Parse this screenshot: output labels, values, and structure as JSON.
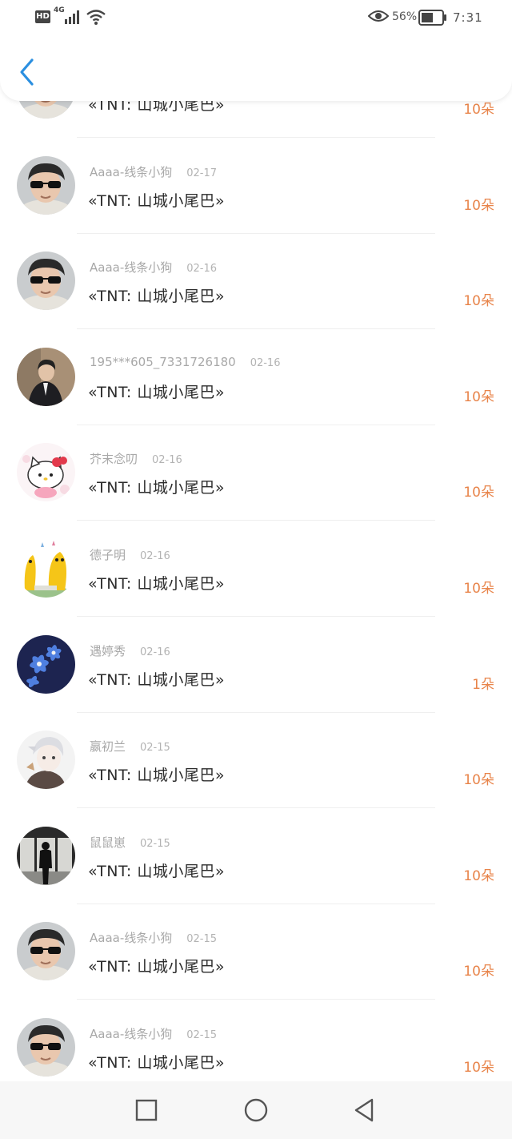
{
  "status_bar": {
    "hd_badge": "HD",
    "network": "4G",
    "battery_percent": "56%",
    "time": "7:31",
    "icons": [
      "hd-icon",
      "signal-icon",
      "wifi-icon",
      "eye-icon",
      "battery-icon"
    ]
  },
  "header": {
    "back_icon": "chevron-left-icon"
  },
  "colors": {
    "accent": "#2b8fe0",
    "count": "#e8844a",
    "meta": "#a8a8a8",
    "title": "#2c2c2c"
  },
  "rows": [
    {
      "user": "",
      "date": "",
      "title": "«TNT: 山城小尾巴»",
      "count": "10朵",
      "avatar": "sunglasses-boy"
    },
    {
      "user": "Aaaa-线条小狗",
      "date": "02-17",
      "title": "«TNT: 山城小尾巴»",
      "count": "10朵",
      "avatar": "sunglasses-boy"
    },
    {
      "user": "Aaaa-线条小狗",
      "date": "02-16",
      "title": "«TNT: 山城小尾巴»",
      "count": "10朵",
      "avatar": "sunglasses-boy"
    },
    {
      "user": "195***605_7331726180",
      "date": "02-16",
      "title": "«TNT: 山城小尾巴»",
      "count": "10朵",
      "avatar": "suit-man"
    },
    {
      "user": "芥末念叨",
      "date": "02-16",
      "title": "«TNT: 山城小尾巴»",
      "count": "10朵",
      "avatar": "hello-kitty"
    },
    {
      "user": "德子明",
      "date": "02-16",
      "title": "«TNT: 山城小尾巴»",
      "count": "10朵",
      "avatar": "yellow-cartoon"
    },
    {
      "user": "遇婷秀",
      "date": "02-16",
      "title": "«TNT: 山城小尾巴»",
      "count": "1朵",
      "avatar": "blue-flowers"
    },
    {
      "user": "嬴初兰",
      "date": "02-15",
      "title": "«TNT: 山城小尾巴»",
      "count": "10朵",
      "avatar": "anime-boy"
    },
    {
      "user": "鼠鼠崽",
      "date": "02-15",
      "title": "«TNT: 山城小尾巴»",
      "count": "10朵",
      "avatar": "silhouette-window"
    },
    {
      "user": "Aaaa-线条小狗",
      "date": "02-15",
      "title": "«TNT: 山城小尾巴»",
      "count": "10朵",
      "avatar": "sunglasses-boy"
    },
    {
      "user": "Aaaa-线条小狗",
      "date": "02-15",
      "title": "«TNT: 山城小尾巴»",
      "count": "10朵",
      "avatar": "sunglasses-boy"
    }
  ],
  "nav_bar": {
    "icons": [
      "recent-apps-icon",
      "home-icon",
      "back-triangle-icon"
    ]
  }
}
